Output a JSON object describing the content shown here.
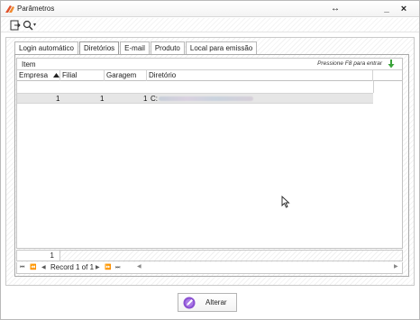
{
  "window": {
    "title": "Parâmetros",
    "resize_glyph": "↔",
    "minimize_glyph": "_",
    "close_glyph": "×",
    "accent_color": "#e0502a"
  },
  "toolbar": {
    "icons": [
      "exit-icon",
      "search-icon",
      "dropdown-caret-icon"
    ],
    "caret_glyph": "▾"
  },
  "tabs": [
    {
      "label": "Login automático",
      "active": false
    },
    {
      "label": "Diretórios",
      "active": true
    },
    {
      "label": "E-mail",
      "active": false
    },
    {
      "label": "Produto",
      "active": false
    },
    {
      "label": "Local para emissão",
      "active": false
    }
  ],
  "grid": {
    "caption": "Item",
    "hint": "Pressione F8 para entrar",
    "columns": [
      {
        "label": "Empresa",
        "sorted": "asc"
      },
      {
        "label": "Filial"
      },
      {
        "label": "Garagem"
      },
      {
        "label": "Diretório"
      }
    ],
    "rows": [
      {
        "empresa": "1",
        "filial": "1",
        "garagem": "1",
        "diretorio": "C:"
      }
    ],
    "footer_count": "1"
  },
  "navigator": {
    "first": "⏮",
    "prev_page": "⏪",
    "prev": "◀",
    "record_text": "Record 1 of 1",
    "next": "▶",
    "next_page": "⏩",
    "last": "⏭",
    "scroll_left": "◀",
    "scroll_right": "▶"
  },
  "actions": {
    "alter_label": "Alterar"
  }
}
